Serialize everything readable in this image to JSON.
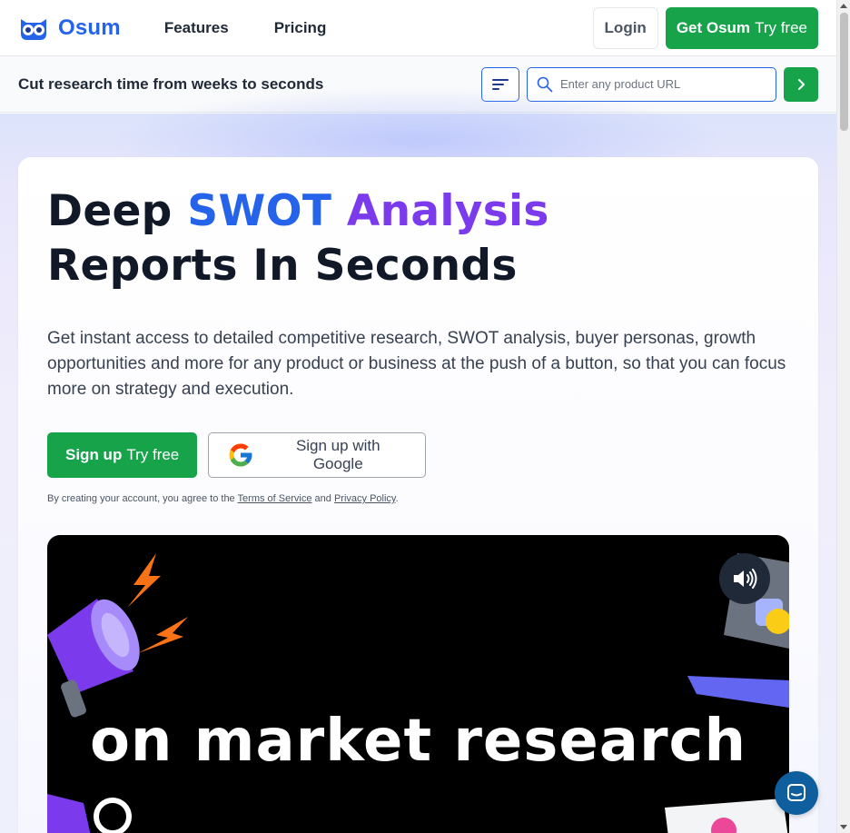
{
  "brand": {
    "name": "Osum",
    "accent": "#2563eb",
    "green": "#16a34a",
    "purple": "#7c3aed"
  },
  "nav": {
    "links": [
      "Features",
      "Pricing"
    ],
    "login": "Login",
    "cta_bold": "Get Osum",
    "cta_light": "Try free"
  },
  "subbar": {
    "title": "Cut research time from weeks to seconds",
    "search_placeholder": "Enter any product URL"
  },
  "hero": {
    "headline_1": "Deep",
    "headline_2": "SWOT",
    "headline_3": "Analysis",
    "headline_4": "Reports In Seconds",
    "description": "Get instant access to detailed competitive research, SWOT analysis, buyer personas, growth opportunities and more for any product or business at the push of a button, so that you can focus more on strategy and execution.",
    "signup_bold": "Sign up",
    "signup_light": "Try free",
    "google_label": "Sign up with Google",
    "terms_prefix": "By creating your account, you agree to the",
    "terms_link": "Terms of Service",
    "terms_and": "and",
    "privacy_link": "Privacy Policy",
    "terms_suffix": "."
  },
  "video": {
    "caption": "on market research"
  },
  "icons": [
    "owl-logo-icon",
    "filter-icon",
    "search-icon",
    "chevron-right-icon",
    "google-g-icon",
    "speaker-icon",
    "chat-icon"
  ]
}
